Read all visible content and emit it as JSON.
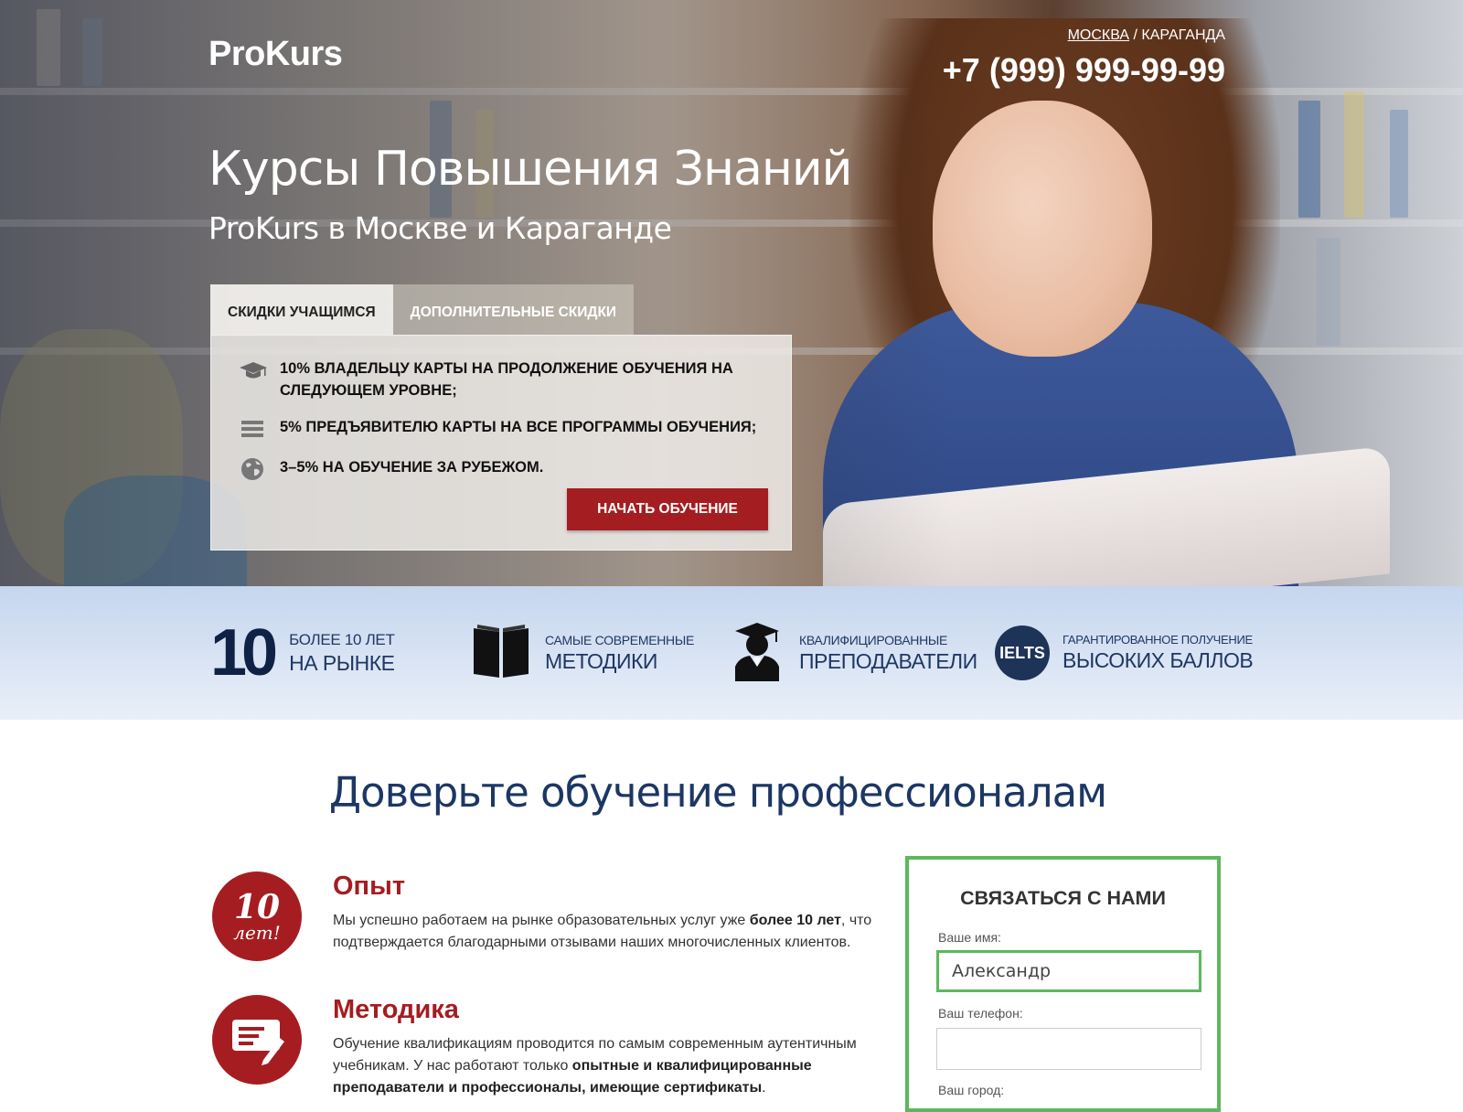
{
  "header": {
    "logo": "ProKurs",
    "city_active": "МОСКВА",
    "city_separator": " / ",
    "city_other": "КАРАГАНДА",
    "phone": "+7 (999) 999-99-99"
  },
  "hero": {
    "title": "Курсы Повышения Знаний",
    "subtitle": "ProKurs в Москве и Караганде",
    "tabs": [
      {
        "label": "СКИДКИ УЧАЩИМСЯ",
        "active": true
      },
      {
        "label": "ДОПОЛНИТЕЛЬНЫЕ СКИДКИ",
        "active": false
      }
    ],
    "discounts": [
      {
        "icon": "graduation-cap-icon",
        "text": "10% ВЛАДЕЛЬЦУ КАРТЫ НА ПРОДОЛЖЕНИЕ ОБУЧЕНИЯ НА СЛЕДУЮЩЕМ УРОВНЕ;"
      },
      {
        "icon": "list-icon",
        "text": "5% ПРЕДЪЯВИТЕЛЮ КАРТЫ НА ВСЕ ПРОГРАММЫ ОБУЧЕНИЯ;"
      },
      {
        "icon": "globe-icon",
        "text": "3–5% НА ОБУЧЕНИЕ ЗА РУБЕЖОМ."
      }
    ],
    "cta_label": "НАЧАТЬ ОБУЧЕНИЕ"
  },
  "features": [
    {
      "big": "10",
      "small": "БОЛЕЕ 10 ЛЕТ",
      "large": "НА РЫНКЕ"
    },
    {
      "icon": "book-icon",
      "small": "САМЫЕ СОВРЕМЕННЫЕ",
      "large": "МЕТОДИКИ"
    },
    {
      "icon": "teacher-icon",
      "small": "КВАЛИФИЦИРОВАННЫЕ",
      "large": "ПРЕПОДАВАТЕЛИ"
    },
    {
      "badge": "IELTS",
      "small": "ГАРАНТИРОВАННОЕ ПОЛУЧЕНИЕ",
      "large": "ВЫСОКИХ БАЛЛОВ"
    }
  ],
  "section": {
    "title": "Доверьте обучение профессионалам",
    "benefits": [
      {
        "badge_number": "10",
        "badge_unit": "лет!",
        "title": "Опыт",
        "text_before": "Мы успешно работаем на рынке образовательных услуг уже ",
        "text_bold": "более 10 лет",
        "text_after": ", что подтверждается благодарными отзывами наших многочисленных клиентов."
      },
      {
        "icon": "certificate-icon",
        "title": "Методика",
        "text_before": "Обучение квалификациям проводится по самым современным аутентичным учебникам. У нас работают только ",
        "text_bold": "опытные и квалифицированные преподаватели и профессионалы, имеющие сертификаты",
        "text_after": "."
      }
    ]
  },
  "contact": {
    "title": "СВЯЗАТЬСЯ С НАМИ",
    "name_label": "Ваше имя:",
    "name_value": "Александр",
    "phone_label": "Ваш телефон:",
    "phone_value": "",
    "city_label": "Ваш город:"
  },
  "colors": {
    "accent_red": "#a41d21",
    "navy": "#1c3764",
    "form_green": "#5cb85c"
  }
}
